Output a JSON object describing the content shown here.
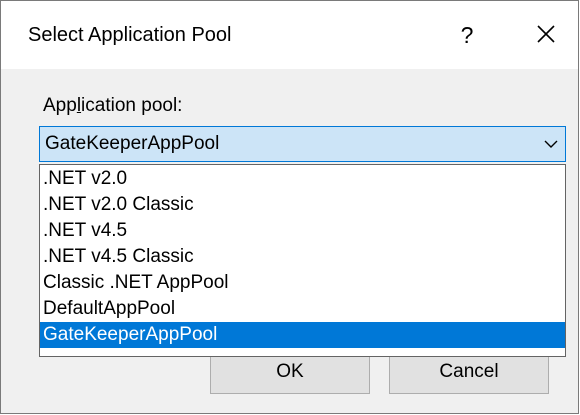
{
  "window": {
    "title": "Select Application Pool",
    "help_label": "?",
    "close_icon": "close-icon"
  },
  "form": {
    "label": "Application pool:",
    "label_mnemonic": "l",
    "selected_value": "GateKeeperAppPool",
    "arrow_icon": "chevron-down-icon"
  },
  "dropdown": {
    "options": [
      ".NET v2.0",
      ".NET v2.0 Classic",
      ".NET v4.5",
      ".NET v4.5 Classic",
      "Classic .NET AppPool",
      "DefaultAppPool",
      "GateKeeperAppPool"
    ],
    "highlighted": "GateKeeperAppPool"
  },
  "buttons": {
    "ok_label": "OK",
    "cancel_label": "Cancel"
  },
  "colors": {
    "accent": "#0078d7",
    "combo_background": "#cce4f7",
    "client_background": "#f0f0f0",
    "button_background": "#e1e1e1"
  }
}
